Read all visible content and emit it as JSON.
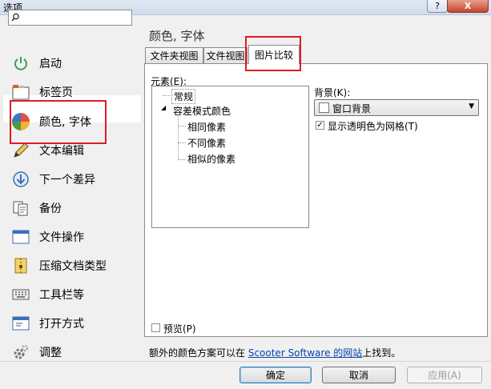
{
  "window": {
    "title": "选项",
    "help_label": "?",
    "close_label": "X"
  },
  "search": {
    "value": "",
    "placeholder": ""
  },
  "sidebar": {
    "items": [
      {
        "label": "启动"
      },
      {
        "label": "标签页"
      },
      {
        "label": "颜色, 字体"
      },
      {
        "label": "文本编辑"
      },
      {
        "label": "下一个差异"
      },
      {
        "label": "备份"
      },
      {
        "label": "文件操作"
      },
      {
        "label": "压缩文档类型"
      },
      {
        "label": "工具栏等"
      },
      {
        "label": "打开方式"
      },
      {
        "label": "调整"
      }
    ],
    "selected_index": 2
  },
  "main": {
    "heading": "颜色, 字体",
    "tabs": [
      {
        "label": "文件夹视图"
      },
      {
        "label": "文件视图"
      },
      {
        "label": "图片比较"
      }
    ],
    "active_tab": 2,
    "elements_label": "元素(E):",
    "tree": {
      "general": "常规",
      "tolerance": "容差模式颜色",
      "children": [
        "相同像素",
        "不同像素",
        "相似的像素"
      ]
    },
    "background_label": "背景(K):",
    "background_value": "窗口背景",
    "grid_label": "显示透明色为网格(T)",
    "grid_checked": true,
    "preview_label": "预览(P)",
    "preview_checked": false
  },
  "footer": {
    "text_before": "额外的颜色方案可以在 ",
    "link": "Scooter Software 的网站",
    "text_after": "上找到。"
  },
  "buttons": {
    "ok": "确定",
    "cancel": "取消",
    "apply": "应用(A)"
  },
  "colors": {
    "highlight_red": "#e01b24",
    "link": "#0645ad"
  }
}
